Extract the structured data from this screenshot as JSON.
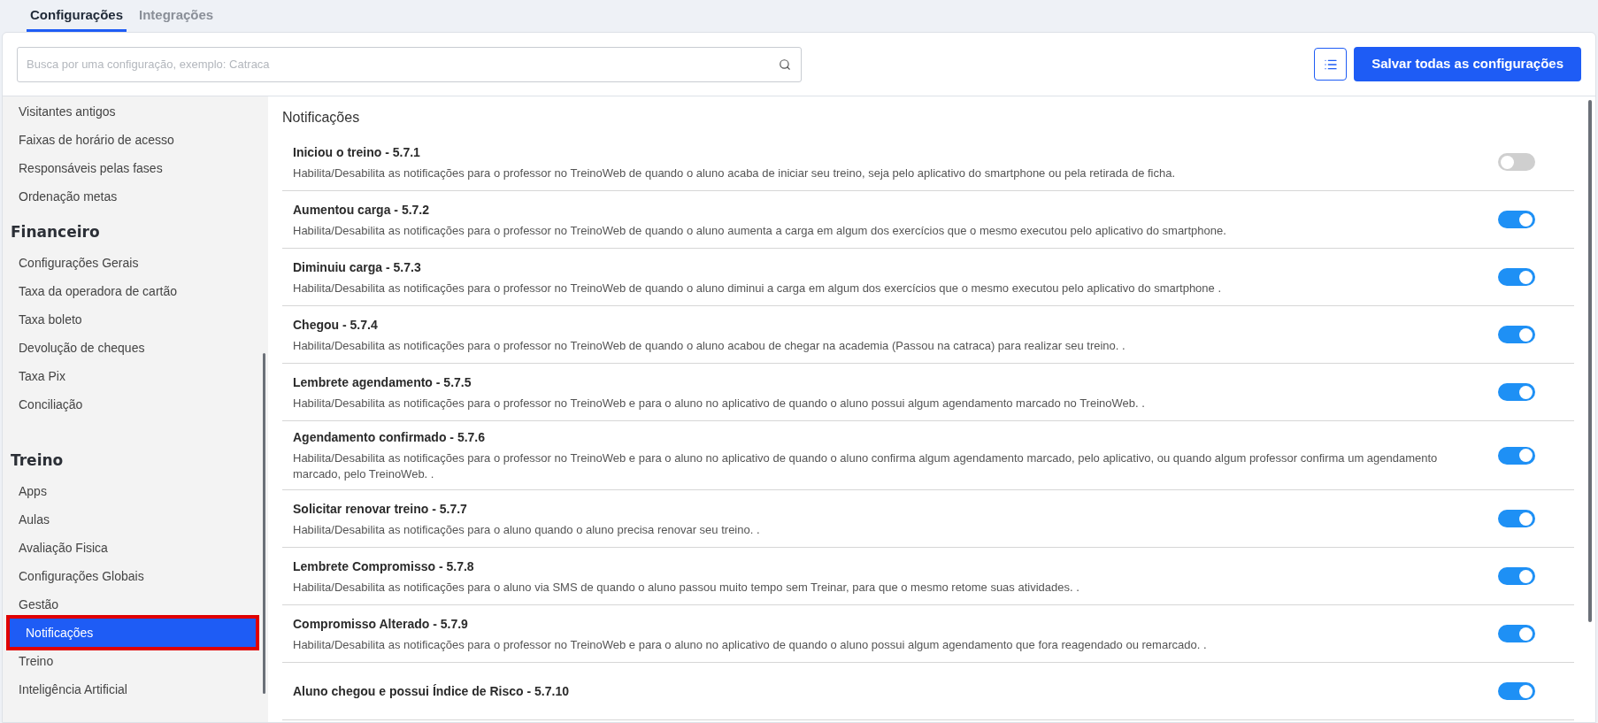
{
  "tabs": [
    {
      "label": "Configurações",
      "selected": true
    },
    {
      "label": "Integrações",
      "selected": false
    }
  ],
  "search": {
    "placeholder": "Busca por uma configuração, exemplo: Catraca"
  },
  "save_button": "Salvar todas as configurações",
  "sidebar": {
    "sections": [
      {
        "items": [
          {
            "label": "Visitantes antigos",
            "selected": false
          },
          {
            "label": "Faixas de horário de acesso",
            "selected": false
          },
          {
            "label": "Responsáveis pelas fases",
            "selected": false
          },
          {
            "label": "Ordenação metas",
            "selected": false
          }
        ]
      },
      {
        "title": "Financeiro",
        "items": [
          {
            "label": "Configurações Gerais",
            "selected": false
          },
          {
            "label": "Taxa da operadora de cartão",
            "selected": false
          },
          {
            "label": "Taxa boleto",
            "selected": false
          },
          {
            "label": "Devolução de cheques",
            "selected": false
          },
          {
            "label": "Taxa Pix",
            "selected": false
          },
          {
            "label": "Conciliação",
            "selected": false
          }
        ]
      },
      {
        "title": "Treino",
        "items": [
          {
            "label": "Apps",
            "selected": false
          },
          {
            "label": "Aulas",
            "selected": false
          },
          {
            "label": "Avaliação Fisica",
            "selected": false
          },
          {
            "label": "Configurações Globais",
            "selected": false
          },
          {
            "label": "Gestão",
            "selected": false
          },
          {
            "label": "Notificações",
            "selected": true
          },
          {
            "label": "Treino",
            "selected": false
          },
          {
            "label": "Inteligência Artificial",
            "selected": false
          }
        ]
      }
    ]
  },
  "content": {
    "title": "Notificações",
    "settings": [
      {
        "title": "Iniciou o treino - 5.7.1",
        "description": "Habilita/Desabilita as notificações para o professor no TreinoWeb de quando o aluno acaba de iniciar seu treino, seja pelo aplicativo do smartphone ou pela retirada de ficha.",
        "on": false
      },
      {
        "title": "Aumentou carga - 5.7.2",
        "description": "Habilita/Desabilita as notificações para o professor no TreinoWeb de quando o aluno aumenta a carga em algum dos exercícios que o mesmo executou pelo aplicativo do smartphone.",
        "on": true
      },
      {
        "title": "Diminuiu carga - 5.7.3",
        "description": "Habilita/Desabilita as notificações para o professor no TreinoWeb de quando o aluno diminui a carga em algum dos exercícios que o mesmo executou pelo aplicativo do smartphone .",
        "on": true
      },
      {
        "title": "Chegou - 5.7.4",
        "description": "Habilita/Desabilita as notificações para o professor no TreinoWeb de quando o aluno acabou de chegar na academia (Passou na catraca) para realizar seu treino. .",
        "on": true
      },
      {
        "title": "Lembrete agendamento - 5.7.5",
        "description": "Habilita/Desabilita as notificações para o professor no TreinoWeb e para o aluno no aplicativo de quando o aluno possui algum agendamento marcado no TreinoWeb. .",
        "on": true
      },
      {
        "title": "Agendamento confirmado - 5.7.6",
        "description": "Habilita/Desabilita as notificações para o professor no TreinoWeb e para o aluno no aplicativo de quando o aluno confirma algum agendamento marcado, pelo aplicativo, ou quando algum professor confirma um agendamento marcado, pelo TreinoWeb. .",
        "on": true
      },
      {
        "title": "Solicitar renovar treino - 5.7.7",
        "description": "Habilita/Desabilita as notificações para o aluno quando o aluno precisa renovar seu treino. .",
        "on": true
      },
      {
        "title": "Lembrete Compromisso - 5.7.8",
        "description": "Habilita/Desabilita as notificações para o aluno via SMS de quando o aluno passou muito tempo sem Treinar, para que o mesmo retome suas atividades. .",
        "on": true
      },
      {
        "title": "Compromisso Alterado - 5.7.9",
        "description": "Habilita/Desabilita as notificações para o professor no TreinoWeb e para o aluno no aplicativo de quando o aluno possui algum agendamento que fora reagendado ou remarcado. .",
        "on": true
      },
      {
        "title": "Aluno chegou e possui Índice de Risco - 5.7.10",
        "on": true
      }
    ]
  }
}
